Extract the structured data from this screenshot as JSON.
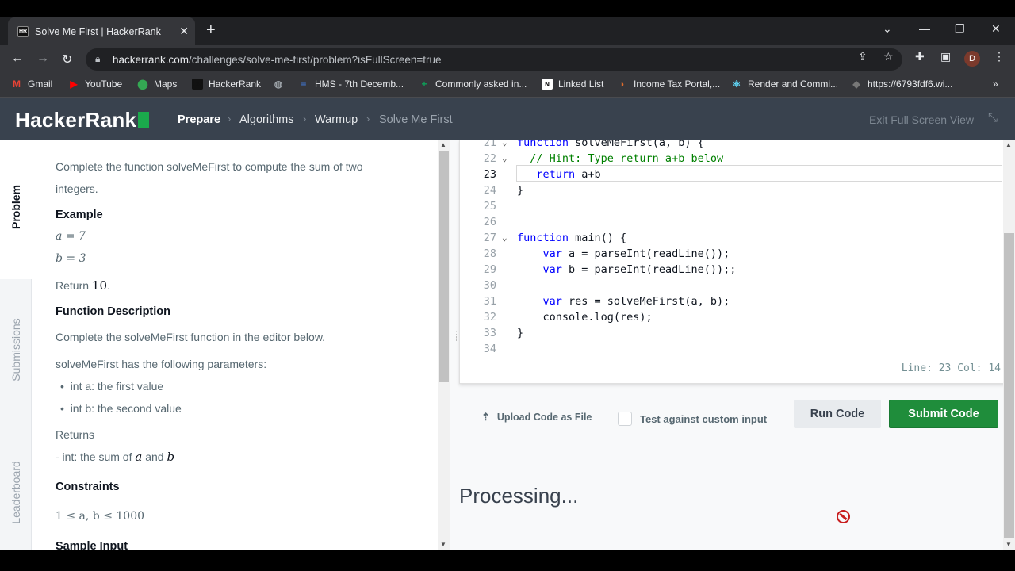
{
  "browser": {
    "tab_title": "Solve Me First | HackerRank",
    "tab_favicon": "HR",
    "url_host": "hackerrank.com",
    "url_path": "/challenges/solve-me-first/problem?isFullScreen=true",
    "profile_initial": "D",
    "bookmarks": [
      {
        "label": "Gmail",
        "icon": "gmail-icon",
        "color": "#ea4335"
      },
      {
        "label": "YouTube",
        "icon": "youtube-icon",
        "color": "#ff0000"
      },
      {
        "label": "Maps",
        "icon": "maps-icon",
        "color": "#34a853"
      },
      {
        "label": "HackerRank",
        "icon": "hackerrank-icon",
        "color": "#111111"
      },
      {
        "label": "",
        "icon": "globe-icon",
        "color": "#9aa0a6"
      },
      {
        "label": "HMS - 7th Decemb...",
        "icon": "docs-icon",
        "color": "#4285f4"
      },
      {
        "label": "Commonly asked in...",
        "icon": "sheets-icon",
        "color": "#0f9d58"
      },
      {
        "label": "Linked List",
        "icon": "notion-icon",
        "color": "#ffffff"
      },
      {
        "label": "Income Tax Portal,...",
        "icon": "income-tax-icon",
        "color": "#e06b2b"
      },
      {
        "label": "Render and Commi...",
        "icon": "react-icon",
        "color": "#61dafb"
      },
      {
        "label": "https://6793fdf6.wi...",
        "icon": "cube-icon",
        "color": "#777777"
      }
    ],
    "bookmarks_more": "»"
  },
  "header": {
    "logo": "HackerRank",
    "breadcrumbs": [
      "Prepare",
      "Algorithms",
      "Warmup",
      "Solve Me First"
    ],
    "exit_fullscreen": "Exit Full Screen View"
  },
  "side_tabs": [
    "Problem",
    "Submissions",
    "Leaderboard"
  ],
  "problem": {
    "intro_line1": "Complete the function solveMeFirst to compute the sum of two",
    "intro_line2": "integers.",
    "example_heading": "Example",
    "example_a": "a = 7",
    "example_b": "b = 3",
    "return_text": "Return",
    "return_value": "10",
    "return_dot": ".",
    "func_desc_heading": "Function Description",
    "func_desc_text": "Complete the solveMeFirst function in the editor below.",
    "params_intro": "solveMeFirst has the following parameters:",
    "params": [
      "int a: the first value",
      "int b: the second value"
    ],
    "returns_heading": "Returns",
    "returns_text_prefix": "- int: the sum of",
    "returns_var_a": "a",
    "returns_and": "and",
    "returns_var_b": "b",
    "constraints_heading": "Constraints",
    "constraints": "1 ≤ a, b ≤ 1000",
    "sample_input_heading": "Sample Input"
  },
  "editor": {
    "lines": [
      {
        "n": "21",
        "fold": true,
        "parts": [
          {
            "t": "function",
            "c": "kw"
          },
          {
            "t": " solveMeFirst(a, b) {",
            "c": ""
          }
        ]
      },
      {
        "n": "22",
        "fold": true,
        "parts": [
          {
            "t": "  // Hint: Type return a+b below",
            "c": "cm"
          }
        ]
      },
      {
        "n": "23",
        "fold": false,
        "current": true,
        "parts": [
          {
            "t": "   ",
            "c": ""
          },
          {
            "t": "return",
            "c": "kw"
          },
          {
            "t": " a+b",
            "c": ""
          }
        ]
      },
      {
        "n": "24",
        "fold": false,
        "parts": [
          {
            "t": "}",
            "c": ""
          }
        ]
      },
      {
        "n": "25",
        "fold": false,
        "parts": []
      },
      {
        "n": "26",
        "fold": false,
        "parts": []
      },
      {
        "n": "27",
        "fold": true,
        "parts": [
          {
            "t": "function",
            "c": "kw"
          },
          {
            "t": " main() {",
            "c": ""
          }
        ]
      },
      {
        "n": "28",
        "fold": false,
        "parts": [
          {
            "t": "    ",
            "c": ""
          },
          {
            "t": "var",
            "c": "kw"
          },
          {
            "t": " a = parseInt(readLine());",
            "c": ""
          }
        ]
      },
      {
        "n": "29",
        "fold": false,
        "parts": [
          {
            "t": "    ",
            "c": ""
          },
          {
            "t": "var",
            "c": "kw"
          },
          {
            "t": " b = parseInt(readLine());;",
            "c": ""
          }
        ]
      },
      {
        "n": "30",
        "fold": false,
        "parts": []
      },
      {
        "n": "31",
        "fold": false,
        "parts": [
          {
            "t": "    ",
            "c": ""
          },
          {
            "t": "var",
            "c": "kw"
          },
          {
            "t": " res = solveMeFirst(a, b);",
            "c": ""
          }
        ]
      },
      {
        "n": "32",
        "fold": false,
        "parts": [
          {
            "t": "    console.log(res);",
            "c": ""
          }
        ]
      },
      {
        "n": "33",
        "fold": false,
        "parts": [
          {
            "t": "}",
            "c": ""
          }
        ]
      },
      {
        "n": "34",
        "fold": false,
        "parts": []
      }
    ],
    "status": "Line: 23 Col: 14"
  },
  "actions": {
    "upload_label": "Upload Code as File",
    "custom_input_label": "Test against custom input",
    "run_label": "Run Code",
    "submit_label": "Submit Code"
  },
  "output": {
    "processing": "Processing..."
  }
}
